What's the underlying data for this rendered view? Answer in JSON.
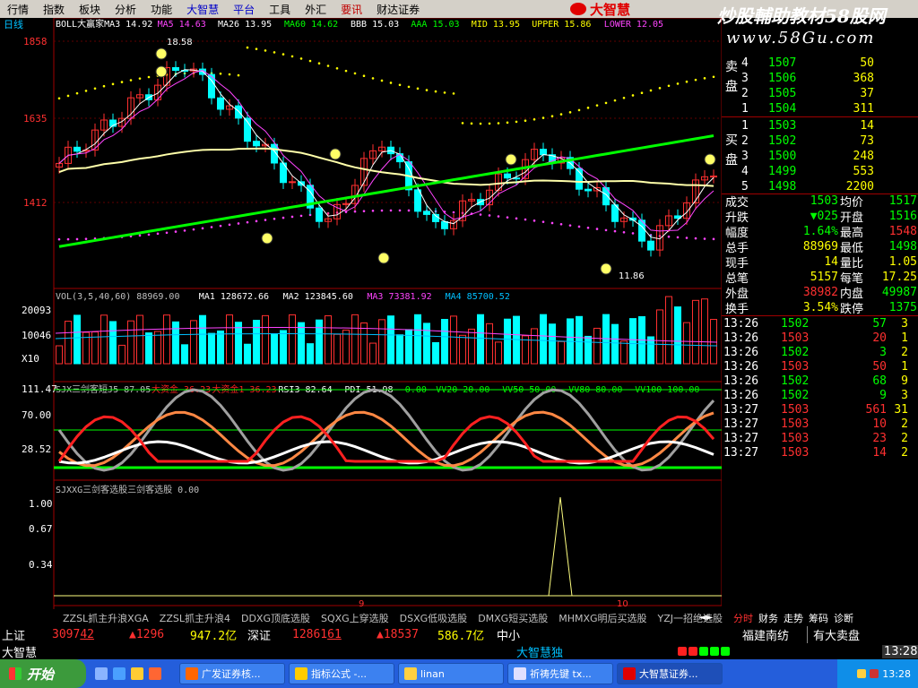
{
  "menu": {
    "items": [
      "行情",
      "指数",
      "板块",
      "分析",
      "功能",
      "大智慧",
      "平台",
      "工具",
      "外汇",
      "要讯",
      "财达证券"
    ]
  },
  "brand": {
    "logo_text": "大智慧",
    "site_title": "炒股輔助教材58股网",
    "site_url": "www.58Gu.com"
  },
  "chart_data": {
    "type": "candlestick",
    "period_label": "日线",
    "price_axis": {
      "ticks": [
        "1858",
        "1635",
        "1412"
      ],
      "ylim": [
        1280,
        1880
      ]
    },
    "annotations": {
      "high": "18.58",
      "low": "11.86"
    },
    "boll_indicators": [
      {
        "label": "BOLL大赢家MA3",
        "value": "14.92",
        "color": "#ffffff"
      },
      {
        "label": "MA5",
        "value": "14.63",
        "color": "#ff44ff"
      },
      {
        "label": "MA26",
        "value": "13.95",
        "color": "#ffffff"
      },
      {
        "label": "MA60",
        "value": "14.62",
        "color": "#00ff00"
      },
      {
        "label": "BBB",
        "value": "15.03",
        "color": "#ffffff"
      },
      {
        "label": "AAA",
        "value": "15.03",
        "color": "#00ff00"
      },
      {
        "label": "MID",
        "value": "13.95",
        "color": "#ffff00"
      },
      {
        "label": "UPPER",
        "value": "15.86",
        "color": "#ffff00"
      },
      {
        "label": "LOWER",
        "value": "12.05",
        "color": "#ff44ff"
      }
    ],
    "volume": {
      "header": [
        {
          "label": "VOL(3,5,40,60)",
          "value": "88969.00",
          "color": "#c0c0c0"
        },
        {
          "label": "MA1",
          "value": "128672.66",
          "color": "#ffffff"
        },
        {
          "label": "MA2",
          "value": "123845.60",
          "color": "#ffffff"
        },
        {
          "label": "MA3",
          "value": "73381.92",
          "color": "#ff44ff"
        },
        {
          "label": "MA4",
          "value": "85700.52",
          "color": "#00c0ff"
        }
      ],
      "ticks": [
        "20093",
        "10046",
        "X10"
      ]
    },
    "oscillator": {
      "header": [
        {
          "label": "SJX三剑客短J5",
          "value": "87.05",
          "color": "#c0c0c0"
        },
        {
          "label": "大资金",
          "value": "36.23",
          "color": "#ff2020"
        },
        {
          "label": "大资金1",
          "value": "36.23",
          "color": "#ff2020"
        },
        {
          "label": "RSI3",
          "value": "82.64",
          "color": "#ffffff"
        },
        {
          "label": "PDI",
          "value": "51.98",
          "color": "#ffffff"
        },
        {
          "label": "",
          "value": "0.00",
          "color": "#00ff00"
        },
        {
          "label": "VV20",
          "value": "20.00",
          "color": "#00ff00"
        },
        {
          "label": "VV50",
          "value": "50.00",
          "color": "#00ff00"
        },
        {
          "label": "VV80",
          "value": "80.00",
          "color": "#00ff00"
        },
        {
          "label": "VV100",
          "value": "100.00",
          "color": "#00ff00"
        }
      ],
      "ticks": [
        "111.47",
        "70.00",
        "28.52"
      ]
    },
    "selector": {
      "header": [
        {
          "label": "SJXXG三剑客选股三剑客选股",
          "value": "0.00",
          "color": "#c0c0c0"
        }
      ],
      "ticks": [
        "1.00",
        "0.67",
        "0.34"
      ]
    },
    "x_ticks": [
      "9",
      "10"
    ]
  },
  "tabs": [
    "ZZSL抓主升浪XGA",
    "ZZSL抓主升浪4",
    "DDXG顶底选股",
    "SQXG上穿选股",
    "DSXG低吸选股",
    "DMXG短买选股",
    "MHMXG明后买选股",
    "YZJ一招绝选股"
  ],
  "right_tabs": [
    "分时",
    "财务",
    "走势",
    "筹码",
    "诊断"
  ],
  "orderbook": {
    "sell_label": "卖盘",
    "buy_label": "买盘",
    "sell": [
      {
        "level": "4",
        "price": "1507",
        "vol": "50"
      },
      {
        "level": "3",
        "price": "1506",
        "vol": "368"
      },
      {
        "level": "2",
        "price": "1505",
        "vol": "37"
      },
      {
        "level": "1",
        "price": "1504",
        "vol": "311"
      }
    ],
    "buy": [
      {
        "level": "1",
        "price": "1503",
        "vol": "14"
      },
      {
        "level": "2",
        "price": "1502",
        "vol": "73"
      },
      {
        "level": "3",
        "price": "1500",
        "vol": "248"
      },
      {
        "level": "4",
        "price": "1499",
        "vol": "553"
      },
      {
        "level": "5",
        "price": "1498",
        "vol": "2200"
      }
    ]
  },
  "stats": [
    {
      "l1": "成交",
      "v1": "1503",
      "l2": "均价",
      "v2": "1517",
      "c1": "#00ff00",
      "c2": "#00ff00"
    },
    {
      "l1": "升跌",
      "v1": "▼025",
      "l2": "开盘",
      "v2": "1516",
      "c1": "#00ff00",
      "c2": "#00ff00"
    },
    {
      "l1": "幅度",
      "v1": "1.64%",
      "l2": "最高",
      "v2": "1548",
      "c1": "#00ff00",
      "c2": "#ff3030"
    },
    {
      "l1": "总手",
      "v1": "88969",
      "l2": "最低",
      "v2": "1498",
      "c1": "#ffff00",
      "c2": "#00ff00"
    },
    {
      "l1": "现手",
      "v1": "14",
      "l2": "量比",
      "v2": "1.05",
      "c1": "#ffff00",
      "c2": "#ffff00"
    },
    {
      "l1": "总笔",
      "v1": "5157",
      "l2": "每笔",
      "v2": "17.25",
      "c1": "#ffff00",
      "c2": "#ffff00"
    },
    {
      "l1": "外盘",
      "v1": "38982",
      "l2": "内盘",
      "v2": "49987",
      "c1": "#ff3030",
      "c2": "#00ff00"
    },
    {
      "l1": "换手",
      "v1": "3.54%",
      "l2": "跌停",
      "v2": "1375",
      "c1": "#ffff00",
      "c2": "#00ff00"
    }
  ],
  "ticks": [
    {
      "time": "13:26",
      "price": "1502",
      "vol": "57",
      "n": "3",
      "color": "#00ff00"
    },
    {
      "time": "13:26",
      "price": "1503",
      "vol": "20",
      "n": "1",
      "color": "#ff3030"
    },
    {
      "time": "13:26",
      "price": "1502",
      "vol": "3",
      "n": "2",
      "color": "#00ff00"
    },
    {
      "time": "13:26",
      "price": "1503",
      "vol": "50",
      "n": "1",
      "color": "#ff3030"
    },
    {
      "time": "13:26",
      "price": "1502",
      "vol": "68",
      "n": "9",
      "color": "#00ff00"
    },
    {
      "time": "13:26",
      "price": "1502",
      "vol": "9",
      "n": "3",
      "color": "#00ff00"
    },
    {
      "time": "13:27",
      "price": "1503",
      "vol": "561",
      "n": "31",
      "color": "#ff3030"
    },
    {
      "time": "13:27",
      "price": "1503",
      "vol": "10",
      "n": "2",
      "color": "#ff3030"
    },
    {
      "time": "13:27",
      "price": "1503",
      "vol": "23",
      "n": "2",
      "color": "#ff3030"
    },
    {
      "time": "13:27",
      "price": "1503",
      "vol": "14",
      "n": "2",
      "color": "#ff3030"
    }
  ],
  "status": {
    "index1_name": "上证",
    "index1_value": "3097",
    "index1_dec": "42",
    "index1_change": "▲1296",
    "index1_amount": "947.2亿",
    "index2_name": "深证",
    "index2_value": "12861",
    "index2_dec": "61",
    "index2_change": "▲18537",
    "index2_amount": "586.7亿",
    "index3_name": "中小",
    "stock_name": "福建南纺",
    "stock_note": "有大卖盘",
    "app_name": "大智慧",
    "ticker": "大智慧独",
    "time": "13:28"
  },
  "taskbar": {
    "start": "开始",
    "items": [
      "广发证券核...",
      "指标公式 -...",
      "linan",
      "祈祷先键 tx...",
      "大智慧证券..."
    ],
    "time": "13:28"
  }
}
